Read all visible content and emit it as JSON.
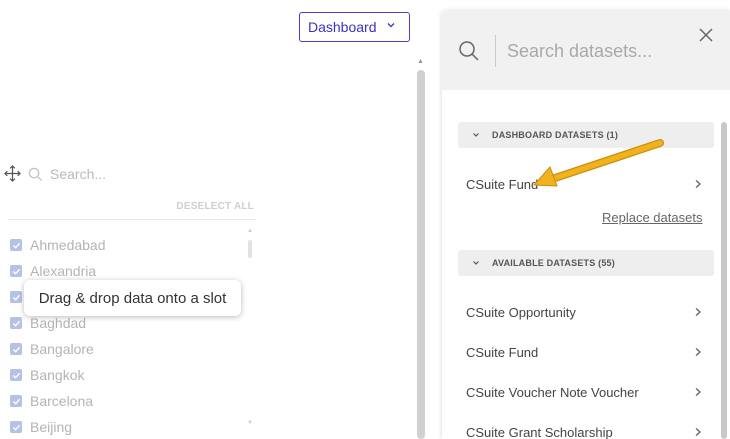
{
  "dashboard_select": {
    "label": "Dashboard"
  },
  "filter_panel": {
    "search_placeholder": "Search...",
    "deselect_all": "DESELECT ALL",
    "items": [
      "Ahmedabad",
      "Alexandria",
      "Baghdad",
      "Bangalore",
      "Bangkok",
      "Barcelona",
      "Beijing"
    ],
    "tooltip": "Drag & drop data onto a slot"
  },
  "dataset_panel": {
    "search_placeholder": "Search datasets...",
    "dashboard_section": {
      "title": "DASHBOARD DATASETS (1)",
      "items": [
        "CSuite Fund"
      ]
    },
    "replace_link": "Replace datasets",
    "available_section": {
      "title": "AVAILABLE DATASETS (55)",
      "items": [
        "CSuite Opportunity",
        "CSuite Fund",
        "CSuite Voucher Note Voucher",
        "CSuite Grant Scholarship"
      ]
    }
  },
  "colors": {
    "accent": "#3d2fc2",
    "checkbox": "#b5c1e6",
    "annotation_arrow": "#f0b21d"
  }
}
